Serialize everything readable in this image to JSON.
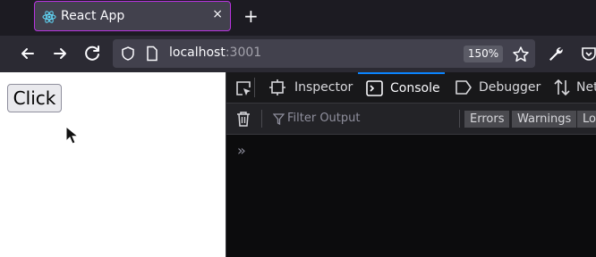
{
  "browser": {
    "tab": {
      "title": "React App",
      "close_icon": "×"
    },
    "new_tab_icon": "+",
    "url": {
      "host": "localhost",
      "port": ":3001"
    },
    "zoom": "150%"
  },
  "page": {
    "button_label": "Click"
  },
  "devtools": {
    "tabs": [
      {
        "label": "Inspector"
      },
      {
        "label": "Console"
      },
      {
        "label": "Debugger"
      },
      {
        "label": "Net"
      }
    ],
    "filter_placeholder": "Filter Output",
    "filters": [
      "Errors",
      "Warnings",
      "Lo"
    ],
    "prompt": "»"
  },
  "colors": {
    "accent_tab_border": "#b833e1",
    "active_tab_indicator": "#0a84ff"
  }
}
